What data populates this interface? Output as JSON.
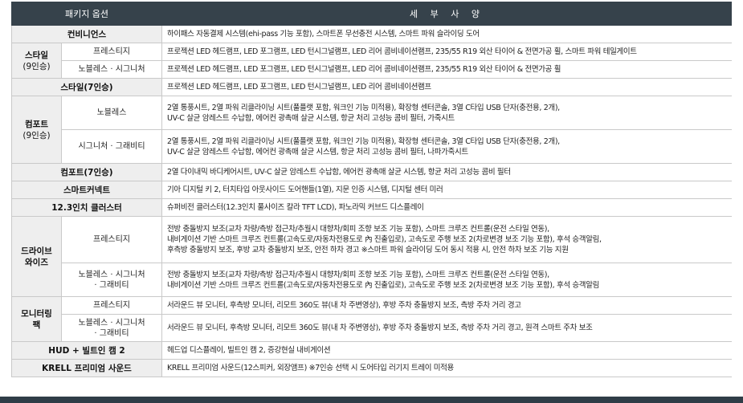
{
  "header": {
    "option_label": "패키지 옵션",
    "spec_label": "세 부 사 양"
  },
  "rows": {
    "convenience": {
      "category": "컨비니언스",
      "spec": "하이패스 자동결제 시스템(ehi-pass 기능 포함), 스마트폰 무선충전 시스템, 스마트 파워 슬라이딩 도어"
    },
    "style9": {
      "category": "스타일",
      "seats": "(9인승)",
      "prestige": {
        "label": "프레스티지",
        "spec": "프로젝션 LED 헤드램프, LED 포그램프, LED 턴시그널램프, LED 리어 콤비네이션램프, 235/55 R19 외산 타이어 & 전면가공 휠, 스마트 파워 테일게이트"
      },
      "noblesse": {
        "label": "노블레스 · 시그니처",
        "spec": "프로젝션 LED 헤드램프, LED 포그램프, LED 턴시그널램프, LED 리어 콤비네이션램프, 235/55 R19 외산 타이어 & 전면가공 휠"
      }
    },
    "style7": {
      "category": "스타일(7인승)",
      "spec": "프로젝션 LED 헤드램프, LED 포그램프, LED 턴시그널램프, LED 리어 콤비네이션램프"
    },
    "comfort9": {
      "category": "컴포트",
      "seats": "(9인승)",
      "noblesse": {
        "label": "노블레스",
        "spec1": "2열 통풍시트, 2열 파워 리클라이닝 시트(풀플랫 포함, 워크인 기능 미적용), 확장형 센터콘솔, 3열 C타입 USB 단자(충전용, 2개),",
        "spec2": "UV-C 살균 암레스트 수납함, 에어컨 광촉매 살균 시스템, 항균 처리 고성능 콤비 필터, 가죽시트"
      },
      "signature": {
        "label": "시그니처 · 그래비티",
        "spec1": "2열 통풍시트, 2열 파워 리클라이닝 시트(풀플랫 포함, 워크인 기능 미적용), 확장형 센터콘솔, 3열 C타입 USB 단자(충전용, 2개),",
        "spec2": "UV-C 살균 암레스트 수납함, 에어컨 광촉매 살균 시스템, 항균 처리 고성능 콤비 필터, 나파가죽시트"
      }
    },
    "comfort7": {
      "category": "컴포트(7인승)",
      "spec": "2열 다이내믹 바디케어시트, UV-C 살균 암레스트 수납함, 에어컨 광촉매 살균 시스템, 항균 처리 고성능 콤비 필터"
    },
    "smart_connect": {
      "category": "스마트커넥트",
      "spec": "기아 디지털 키 2, 터치타입 아웃사이드 도어핸들(1열), 지문 인증 시스템, 디지털 센터 미러"
    },
    "cluster": {
      "category": "12.3인치 클러스터",
      "spec": "슈퍼비전 클러스터(12.3인치 풀사이즈 칼라 TFT LCD), 파노라믹 커브드 디스플레이"
    },
    "drivewise": {
      "category_line1": "드라이브",
      "category_line2": "와이즈",
      "prestige": {
        "label": "프레스티지",
        "spec1": "전방 충돌방지 보조(교차 차량/측방 접근차/추월시 대향차/회피 조향 보조 기능 포함), 스마트 크루즈 컨트롤(운전 스타일 연동),",
        "spec2": "내비게이션 기반 스마트 크루즈 컨트롤(고속도로/자동차전용도로 內 진출입로), 고속도로 주행 보조 2(차로변경 보조 기능 포함), 후석 승객알림,",
        "spec3": "후측방 충돌방지 보조, 후방 교차 충돌방지 보조, 안전 하차 경고   ※스마트 파워 슬라이딩 도어 동시 적용 시, 안전 하차 보조 기능 지원"
      },
      "noblesse": {
        "label1": "노블레스 · 시그니처",
        "label2": "· 그래비티",
        "spec1": "전방 충돌방지 보조(교차 차량/측방 접근차/추월시 대향차/회피 조향 보조 기능 포함), 스마트 크루즈 컨트롤(운전 스타일 연동),",
        "spec2": "내비게이션 기반 스마트 크루즈 컨트롤(고속도로/자동차전용도로 內 진출입로), 고속도로 주행 보조 2(차로변경 보조 기능 포함), 후석 승객알림"
      }
    },
    "monitoring": {
      "category_line1": "모니터링",
      "category_line2": "팩",
      "prestige": {
        "label": "프레스티지",
        "spec": "서라운드 뷰 모니터, 후측방 모니터, 리모트 360도 뷰(내 차 주변영상), 후방 주차 충돌방지 보조, 측방 주차 거리 경고"
      },
      "noblesse": {
        "label1": "노블레스 · 시그니처",
        "label2": "· 그래비티",
        "spec": "서라운드 뷰 모니터, 후측방 모니터, 리모트 360도 뷰(내 차 주변영상), 후방 주차 충돌방지 보조, 측방 주차 거리 경고, 원격 스마트 주차 보조"
      }
    },
    "hud": {
      "category": "HUD + 빌트인 캠 2",
      "spec": "헤드업 디스플레이, 빌트인 캠 2, 증강현실 내비게이션"
    },
    "krell": {
      "category": "KRELL 프리미엄 사운드",
      "spec": "KRELL 프리미엄 사운드(12스피커, 외장앰프)   ※7인승 선택 시 도어타입 러기지 트레이 미적용"
    }
  }
}
